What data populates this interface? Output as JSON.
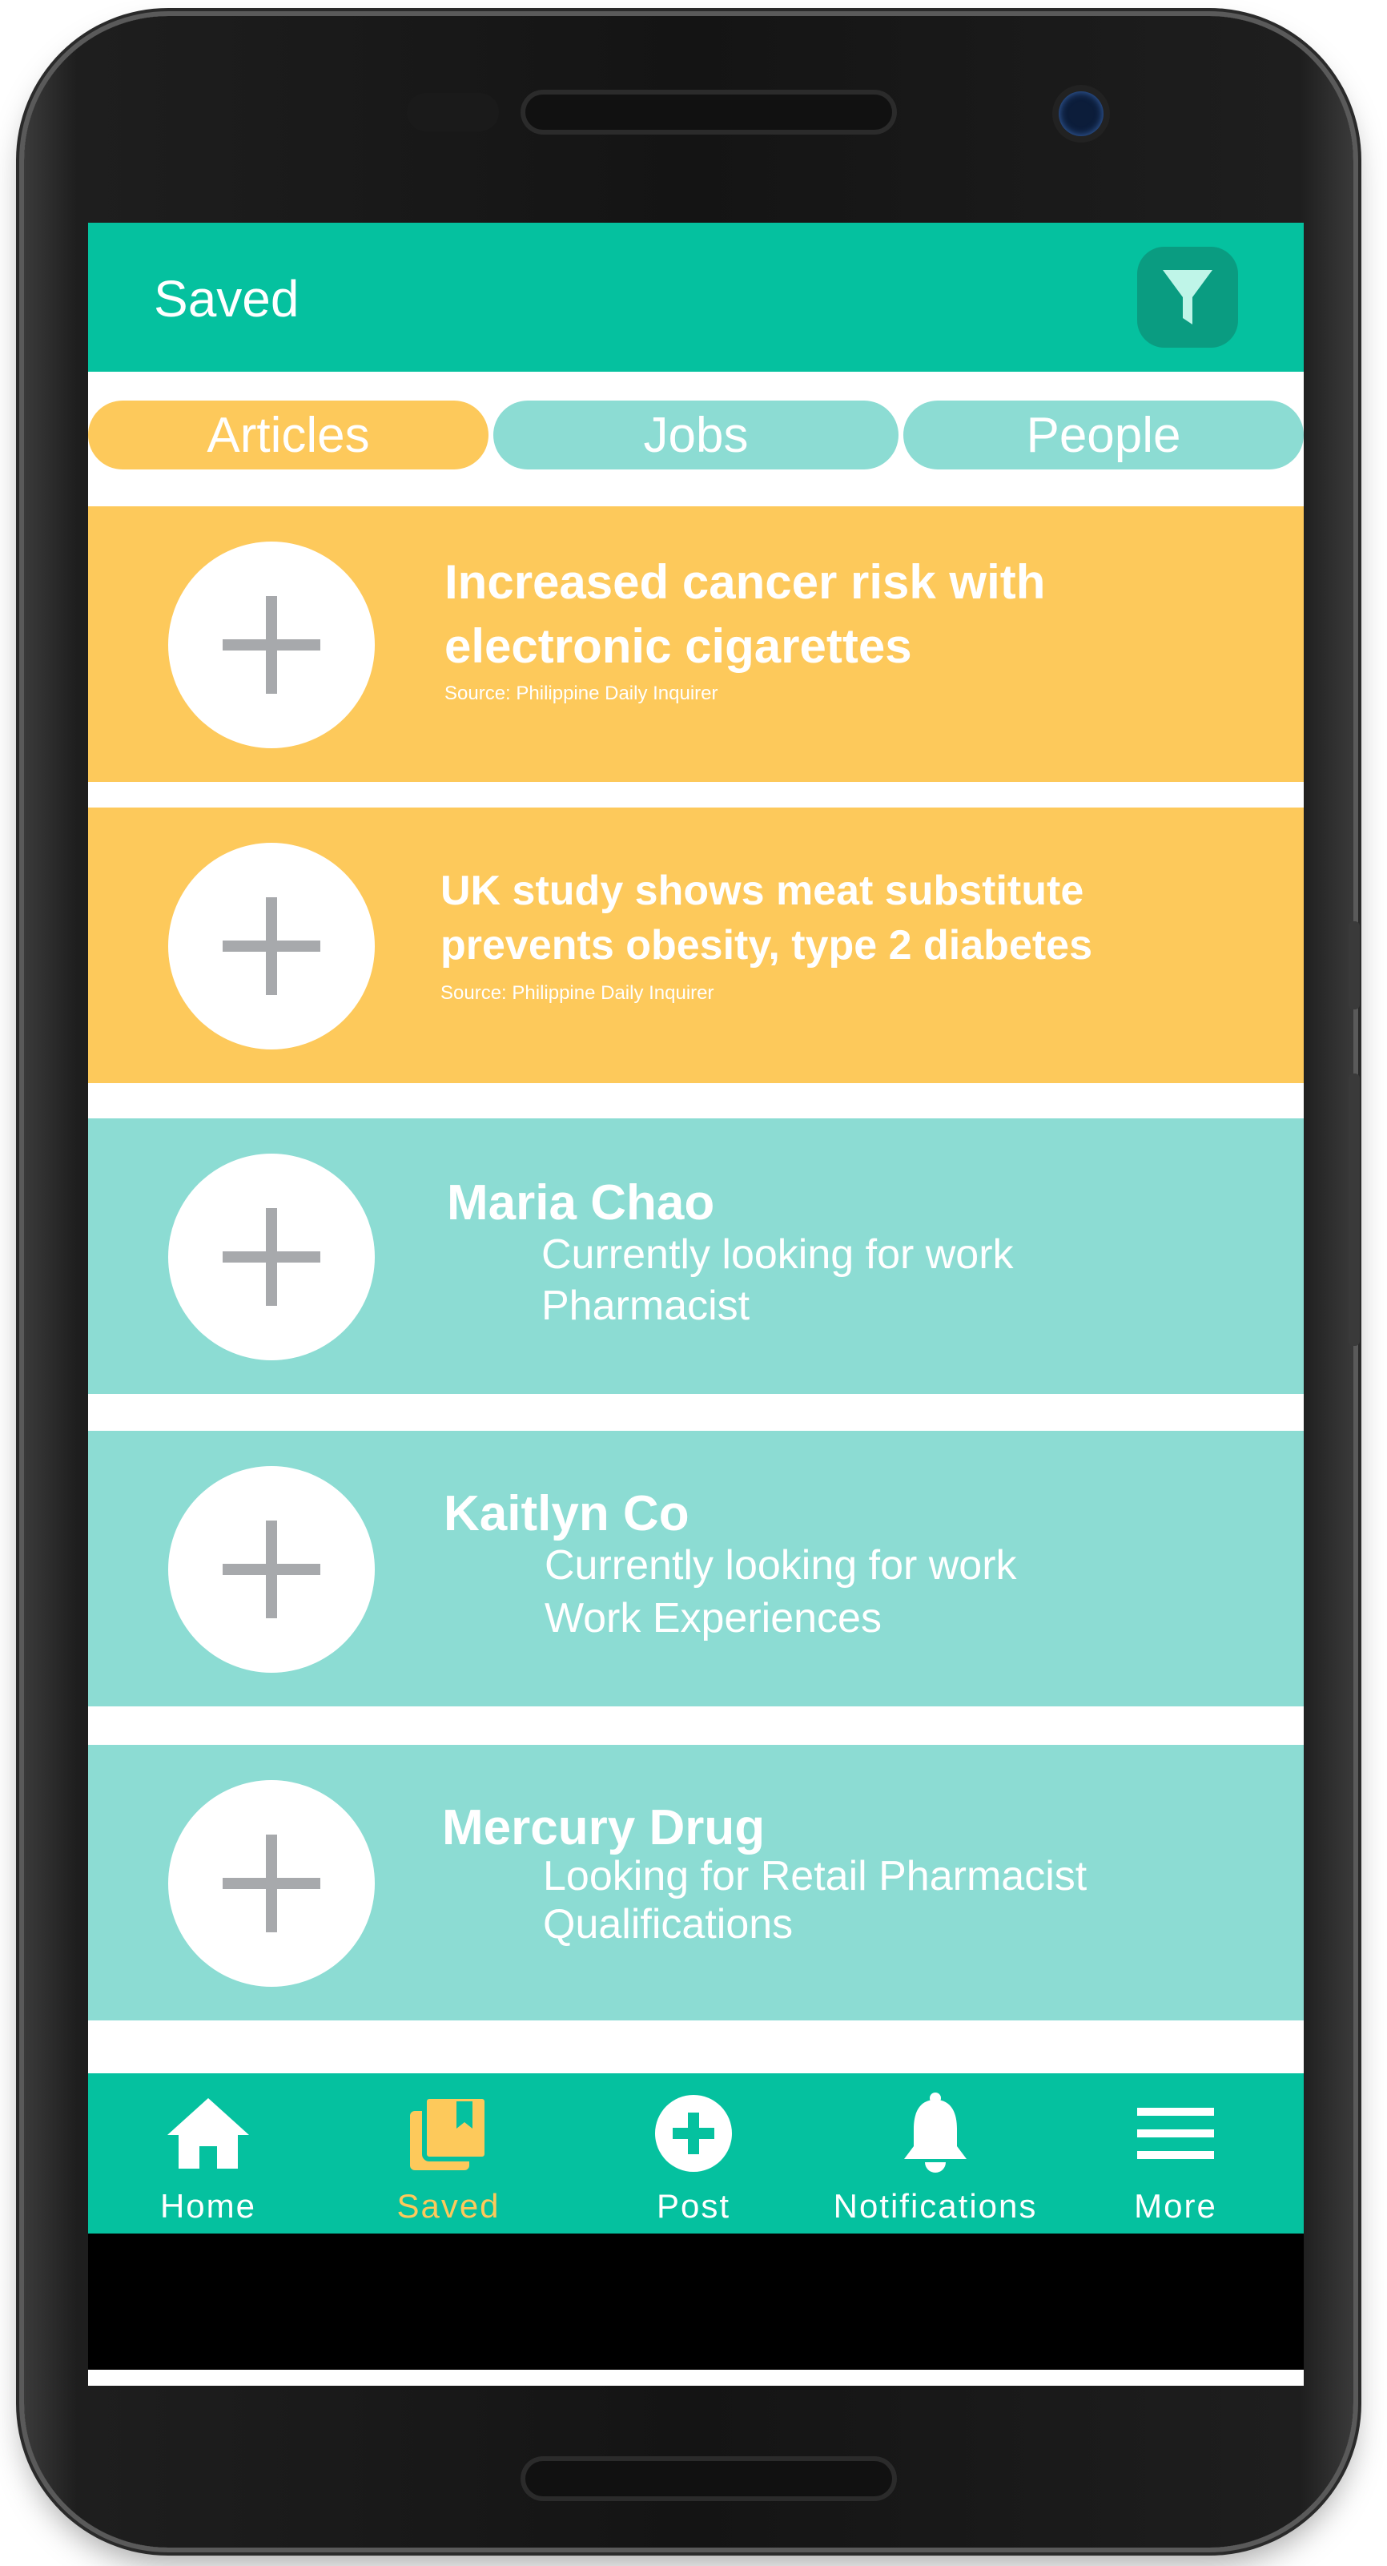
{
  "appbar": {
    "title": "Saved",
    "filter_icon": "filter-icon"
  },
  "tabs": [
    {
      "label": "Articles",
      "active": true
    },
    {
      "label": "Jobs",
      "active": false
    },
    {
      "label": "People",
      "active": false
    }
  ],
  "articles": [
    {
      "title_line1": "Increased cancer risk with",
      "title_line2": "electronic cigarettes",
      "source": "Source: Philippine Daily Inquirer"
    },
    {
      "title_line1": "UK study shows meat substitute",
      "title_line2": "prevents obesity, type 2 diabetes",
      "source": "Source: Philippine Daily Inquirer"
    }
  ],
  "people": [
    {
      "name": "Maria Chao",
      "line1": "Currently looking for work",
      "line2": "Pharmacist"
    },
    {
      "name": "Kaitlyn Co",
      "line1": "Currently looking for work",
      "line2": "Work Experiences"
    },
    {
      "name": "Mercury Drug",
      "line1": "Looking for Retail Pharmacist",
      "line2": "Qualifications"
    }
  ],
  "bottom_nav": [
    {
      "label": "Home",
      "icon": "home-icon",
      "active": false
    },
    {
      "label": "Saved",
      "icon": "saved-icon",
      "active": true
    },
    {
      "label": "Post",
      "icon": "post-icon",
      "active": false
    },
    {
      "label": "Notifications",
      "icon": "bell-icon",
      "active": false
    },
    {
      "label": "More",
      "icon": "menu-icon",
      "active": false
    }
  ],
  "colors": {
    "primary": "#05c19f",
    "primary_dark": "#0a9c81",
    "article": "#fdc95b",
    "person": "#8cdcd3",
    "plus": "#a7a9ac"
  }
}
